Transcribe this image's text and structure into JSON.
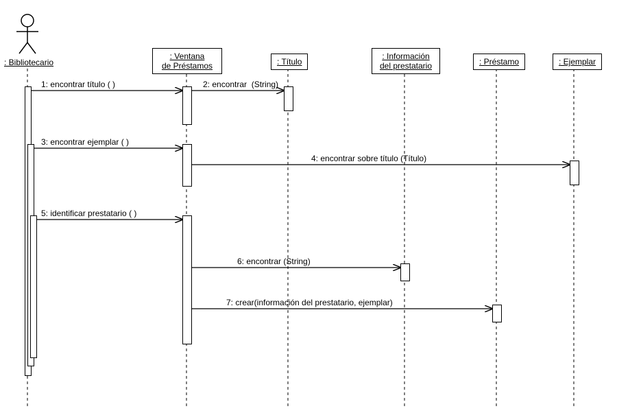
{
  "diagram_type": "UML Sequence Diagram",
  "actor": {
    "label": ": Bibliotecario"
  },
  "lifelines": [
    {
      "id": "ventana",
      "label": ": Ventana\nde Préstamos"
    },
    {
      "id": "titulo",
      "label": ": Título"
    },
    {
      "id": "info",
      "label": ": Información\ndel prestatario"
    },
    {
      "id": "prestamo",
      "label": ": Préstamo"
    },
    {
      "id": "ejemplar",
      "label": ": Ejemplar"
    }
  ],
  "messages": {
    "m1": "1: encontrar título ( )",
    "m2": "2: encontrar  (String)",
    "m3": "3: encontrar ejemplar ( )",
    "m4": "4: encontrar sobre título (Título)",
    "m5": "5: identificar prestatario ( )",
    "m6": "6: encontrar (String)",
    "m7": "7: crear(información del prestatario, ejemplar)"
  },
  "chart_data": {
    "type": "uml-sequence",
    "participants": [
      "Bibliotecario",
      "Ventana de Préstamos",
      "Título",
      "Información del prestatario",
      "Préstamo",
      "Ejemplar"
    ],
    "calls": [
      {
        "n": 1,
        "from": "Bibliotecario",
        "to": "Ventana de Préstamos",
        "msg": "encontrar título ( )"
      },
      {
        "n": 2,
        "from": "Ventana de Préstamos",
        "to": "Título",
        "msg": "encontrar (String)"
      },
      {
        "n": 3,
        "from": "Bibliotecario",
        "to": "Ventana de Préstamos",
        "msg": "encontrar ejemplar ( )"
      },
      {
        "n": 4,
        "from": "Ventana de Préstamos",
        "to": "Ejemplar",
        "msg": "encontrar sobre título (Título)"
      },
      {
        "n": 5,
        "from": "Bibliotecario",
        "to": "Ventana de Préstamos",
        "msg": "identificar prestatario ( )"
      },
      {
        "n": 6,
        "from": "Ventana de Préstamos",
        "to": "Información del prestatario",
        "msg": "encontrar (String)"
      },
      {
        "n": 7,
        "from": "Ventana de Préstamos",
        "to": "Préstamo",
        "msg": "crear(información del prestatario, ejemplar)"
      }
    ]
  }
}
